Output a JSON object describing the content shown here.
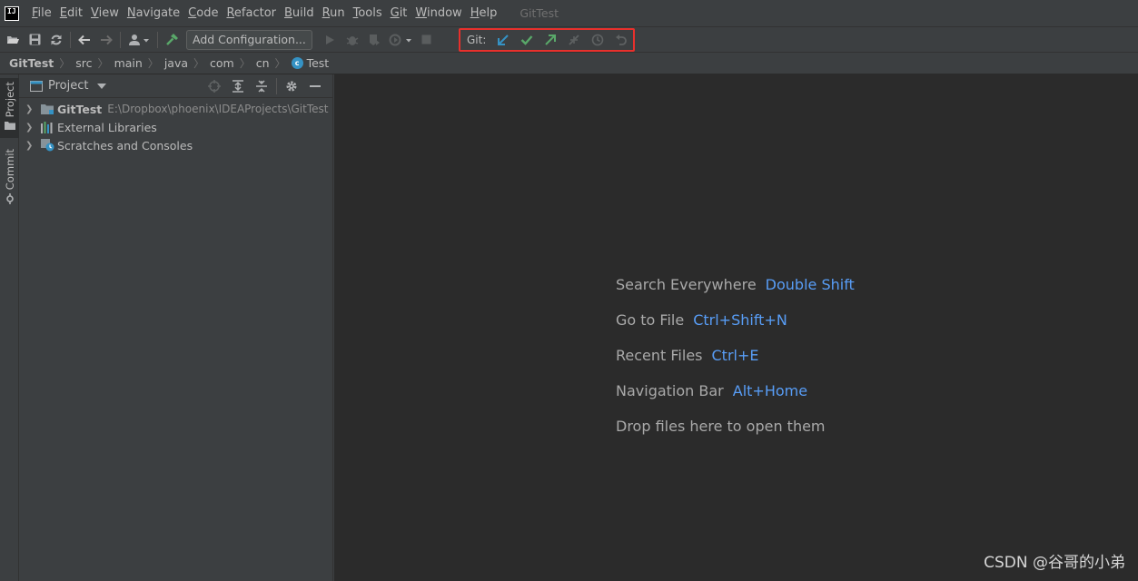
{
  "menu": {
    "items": [
      {
        "mn": "F",
        "rest": "ile"
      },
      {
        "mn": "E",
        "rest": "dit"
      },
      {
        "mn": "V",
        "rest": "iew"
      },
      {
        "mn": "N",
        "rest": "avigate"
      },
      {
        "mn": "C",
        "rest": "ode"
      },
      {
        "mn": "R",
        "rest": "efactor"
      },
      {
        "mn": "B",
        "rest": "uild"
      },
      {
        "mn": "R",
        "rest": "un"
      },
      {
        "mn": "T",
        "rest": "ools"
      },
      {
        "mn": "G",
        "rest": "it"
      },
      {
        "mn": "W",
        "rest": "indow"
      },
      {
        "mn": "H",
        "rest": "elp"
      }
    ],
    "window_title": "GitTest",
    "logo_text": "IJ"
  },
  "toolbar": {
    "add_configuration": "Add Configuration...",
    "git_label": "Git:",
    "git_actions": [
      "update-project-icon",
      "commit-icon",
      "push-icon",
      "pull-request-icon",
      "history-icon",
      "rollback-icon"
    ]
  },
  "breadcrumb": [
    "GitTest",
    "src",
    "main",
    "java",
    "com",
    "cn",
    "Test"
  ],
  "strip": {
    "project": "Project",
    "commit": "Commit"
  },
  "project_panel": {
    "title": "Project",
    "tree": [
      {
        "label": "GitTest",
        "path": "E:\\Dropbox\\phoenix\\IDEAProjects\\GitTest",
        "bold": true
      },
      {
        "label": "External Libraries",
        "path": "",
        "bold": false
      },
      {
        "label": "Scratches and Consoles",
        "path": "",
        "bold": false
      }
    ]
  },
  "editor": {
    "hints": [
      {
        "text": "Search Everywhere",
        "key": "Double Shift"
      },
      {
        "text": "Go to File",
        "key": "Ctrl+Shift+N"
      },
      {
        "text": "Recent Files",
        "key": "Ctrl+E"
      },
      {
        "text": "Navigation Bar",
        "key": "Alt+Home"
      },
      {
        "text": "Drop files here to open them",
        "key": ""
      }
    ],
    "watermark": "CSDN @谷哥的小弟"
  },
  "colors": {
    "git_highlight": "#e8302c",
    "shortcut": "#589df6",
    "editor_bg": "#2b2b2b",
    "panel_bg": "#3c3f41"
  }
}
